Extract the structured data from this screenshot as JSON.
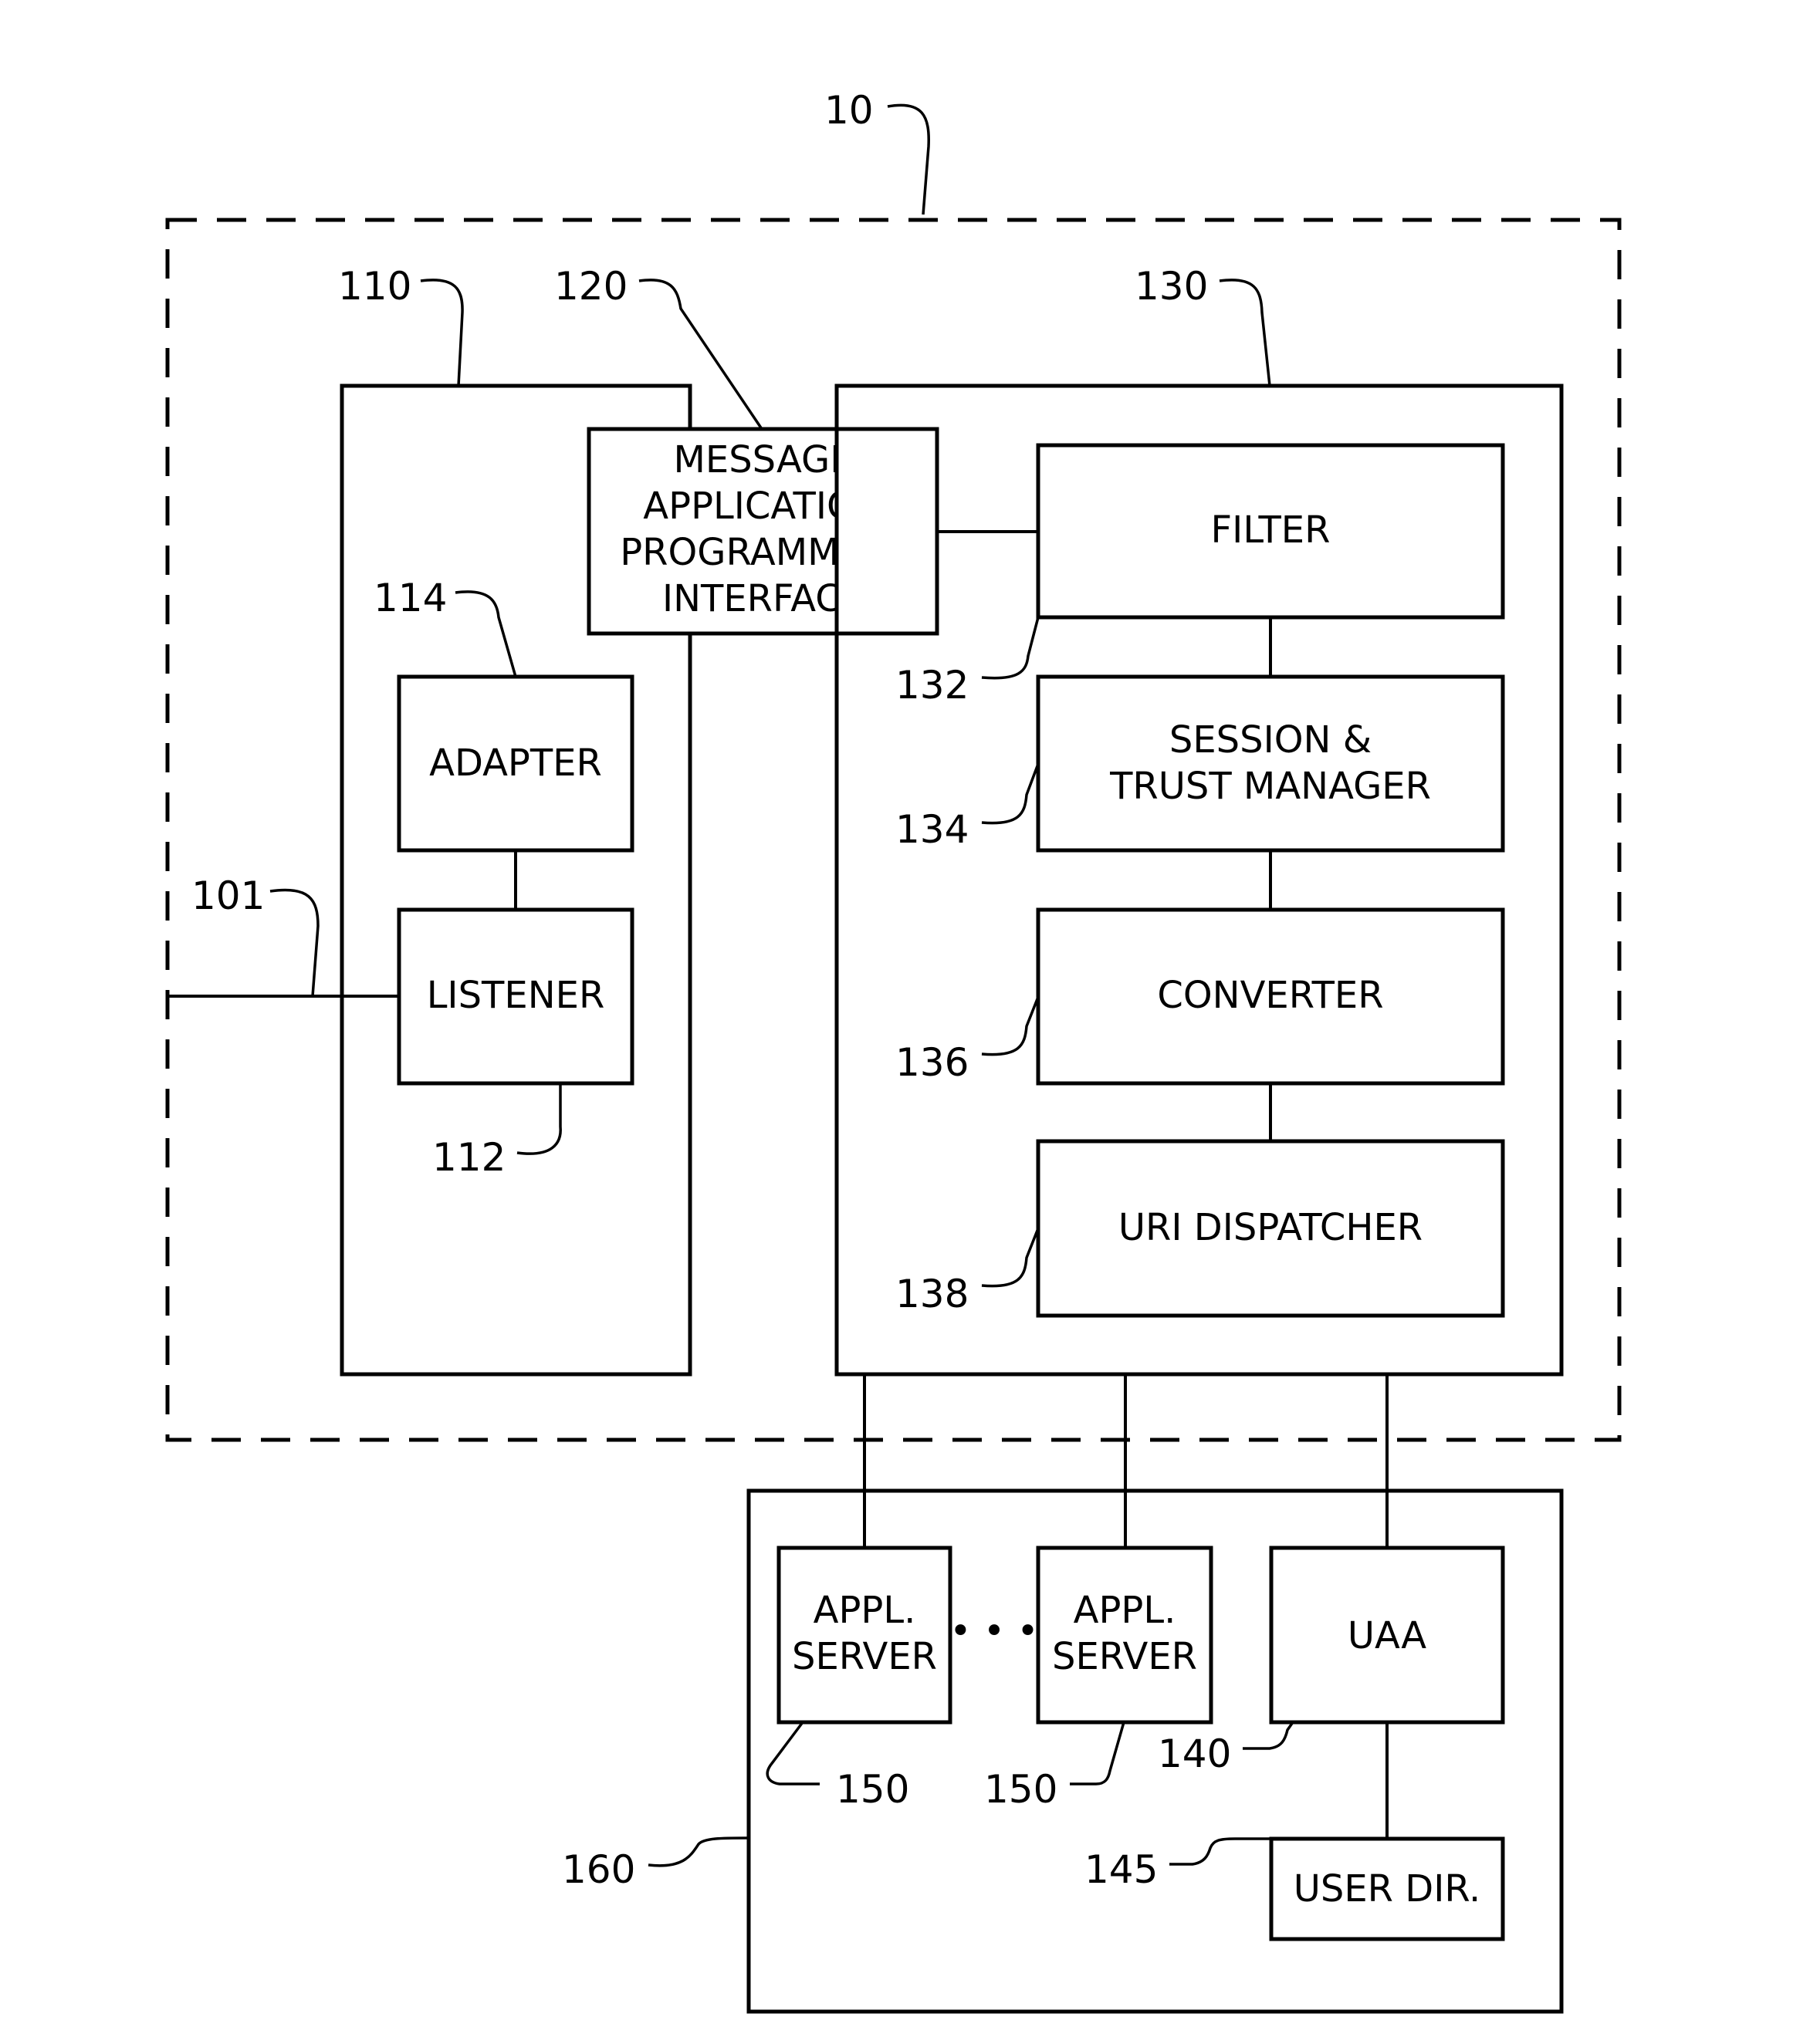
{
  "figure": {
    "system_ref": "10",
    "input_ref": "101",
    "left_component": {
      "ref": "110",
      "adapter": {
        "ref": "114",
        "label": "ADAPTER"
      },
      "listener": {
        "ref": "112",
        "label": "LISTENER"
      }
    },
    "api": {
      "ref": "120",
      "lines": [
        "MESSAGE",
        "APPLICATION",
        "PROGRAMMING",
        "INTERFACE"
      ]
    },
    "right_component": {
      "ref": "130",
      "filter": {
        "ref": "132",
        "label": "FILTER"
      },
      "session": {
        "ref": "134",
        "lines": [
          "SESSION &",
          "TRUST MANAGER"
        ]
      },
      "converter": {
        "ref": "136",
        "label": "CONVERTER"
      },
      "dispatcher": {
        "ref": "138",
        "label": "URI DISPATCHER"
      }
    },
    "backend": {
      "ref": "160",
      "server1": {
        "ref": "150",
        "lines": [
          "APPL.",
          "SERVER"
        ]
      },
      "ellipsis": "• • •",
      "server2": {
        "ref": "150",
        "lines": [
          "APPL.",
          "SERVER"
        ]
      },
      "uaa": {
        "ref": "140",
        "label": "UAA"
      },
      "user_dir": {
        "ref": "145",
        "label": "USER DIR."
      }
    }
  }
}
